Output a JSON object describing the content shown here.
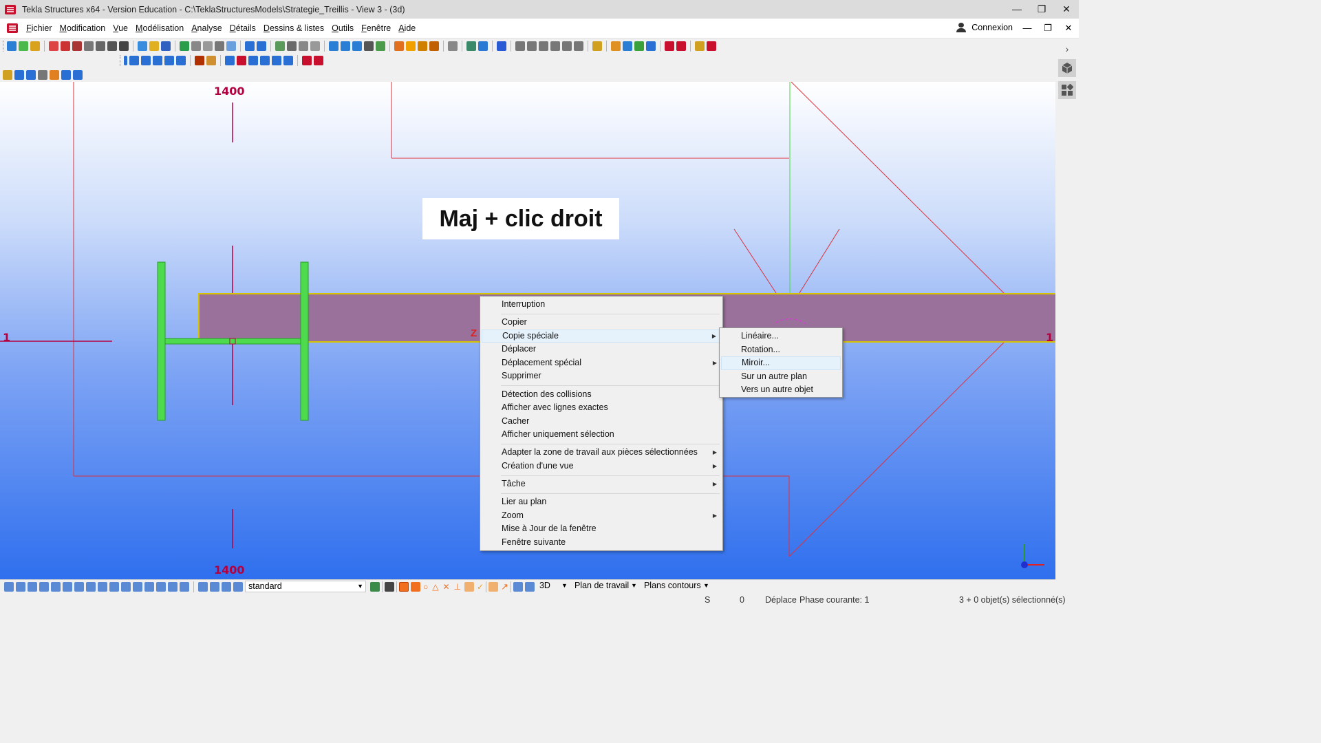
{
  "window": {
    "title": "Tekla Structures x64 - Version Education - C:\\TeklaStructuresModels\\Strategie_Treillis  - View 3 - (3d)",
    "minimize": "—",
    "restore": "❐",
    "close": "✕"
  },
  "menubar": {
    "items": [
      "Fichier",
      "Modification",
      "Vue",
      "Modélisation",
      "Analyse",
      "Détails",
      "Dessins & listes",
      "Outils",
      "Fenêtre",
      "Aide"
    ],
    "connexion": "Connexion"
  },
  "viewport": {
    "overlay_text": "Maj + clic droit",
    "grid_labels": {
      "top": "1400",
      "bottom": "1400",
      "left": "1",
      "right": "1"
    },
    "z_marker": "Z",
    "colors": {
      "grid_line": "#e0303c",
      "part_fill": "#9a719a",
      "part_edge": "#d6c400",
      "profile": "#4ddb4d",
      "green_axis": "#44dd44"
    }
  },
  "context_menu": {
    "items": [
      {
        "label": "Interruption"
      },
      {
        "sep": true
      },
      {
        "label": "Copier"
      },
      {
        "label": "Copie spéciale",
        "submenu": true,
        "highlight": true
      },
      {
        "label": "Déplacer"
      },
      {
        "label": "Déplacement spécial",
        "submenu": true
      },
      {
        "label": "Supprimer"
      },
      {
        "sep": true
      },
      {
        "label": "Détection des collisions"
      },
      {
        "label": "Afficher avec lignes exactes"
      },
      {
        "label": "Cacher"
      },
      {
        "label": "Afficher uniquement sélection"
      },
      {
        "sep": true
      },
      {
        "label": "Adapter la zone de travail aux pièces sélectionnées",
        "submenu": true
      },
      {
        "label": "Création d'une vue",
        "submenu": true
      },
      {
        "sep": true
      },
      {
        "label": "Tâche",
        "submenu": true
      },
      {
        "sep": true
      },
      {
        "label": "Lier au plan"
      },
      {
        "label": "Zoom",
        "submenu": true
      },
      {
        "label": "Mise à Jour de la fenêtre"
      },
      {
        "label": "Fenêtre suivante"
      }
    ]
  },
  "sub_menu": {
    "items": [
      {
        "label": "Linéaire..."
      },
      {
        "label": "Rotation..."
      },
      {
        "label": "Miroir...",
        "highlight": true
      },
      {
        "label": "Sur un autre plan"
      },
      {
        "label": "Vers un autre objet"
      }
    ]
  },
  "bottom_toolbar": {
    "filter_select": "standard",
    "view_mode": "3D",
    "work_plane": "Plan de travail",
    "contour_planes": "Plans contours"
  },
  "statusbar": {
    "s": "S",
    "zero": "0",
    "deplace": "Déplace",
    "phase": "Phase courante: 1",
    "selection": "3 + 0 objet(s) sélectionné(s)"
  }
}
